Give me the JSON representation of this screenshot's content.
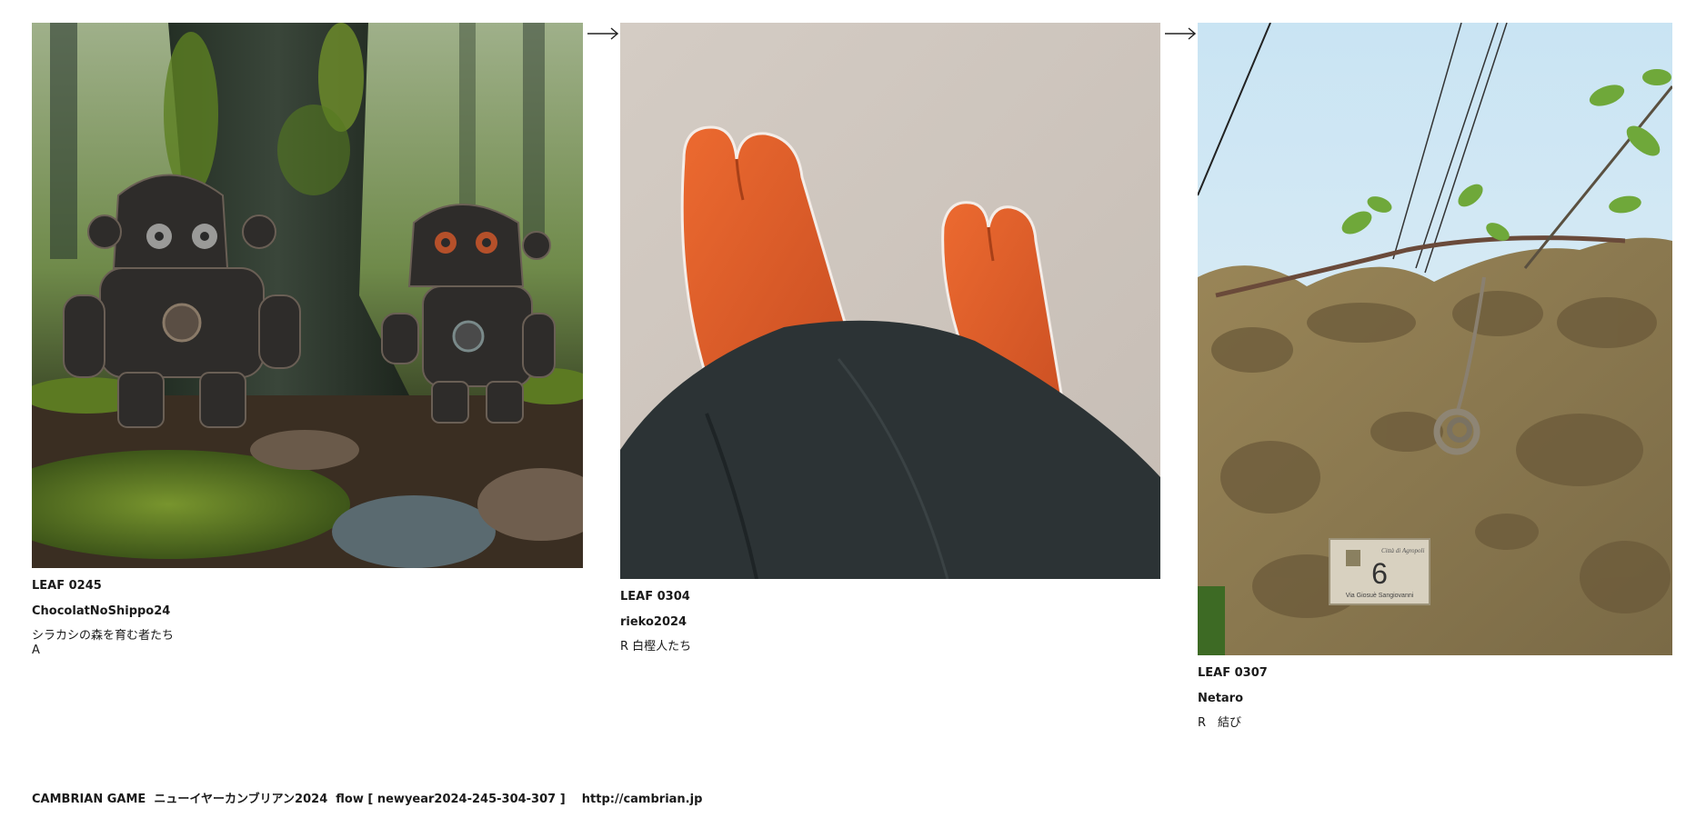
{
  "leaves": [
    {
      "id": "LEAF 0245",
      "author": "ChocolatNoShippo24",
      "title": "シラカシの森を育む者たち\nA"
    },
    {
      "id": "LEAF 0304",
      "author": "rieko2024",
      "title": "R 白樫人たち"
    },
    {
      "id": "LEAF 0307",
      "author": "Netaro",
      "title": "R　結び",
      "sign": {
        "city": "Città di Agropoli",
        "number": "6",
        "street": "Via Giosuè Sangiovanni"
      }
    }
  ],
  "footer": {
    "text": "CAMBRIAN GAME  ニューイヤーカンブリアン2024  flow [ newyear2024-245-304-307 ]    http://cambrian.jp"
  },
  "colors": {
    "moss": "#4f6a1e",
    "tabi_orange": "#e2602c",
    "floor": "#cfc7bf",
    "trousers": "#2c3335",
    "sky": "#cfe6f3",
    "stone": "#8b7a50"
  },
  "icons": [
    "arrow-right-icon",
    "arrow-right-icon"
  ]
}
